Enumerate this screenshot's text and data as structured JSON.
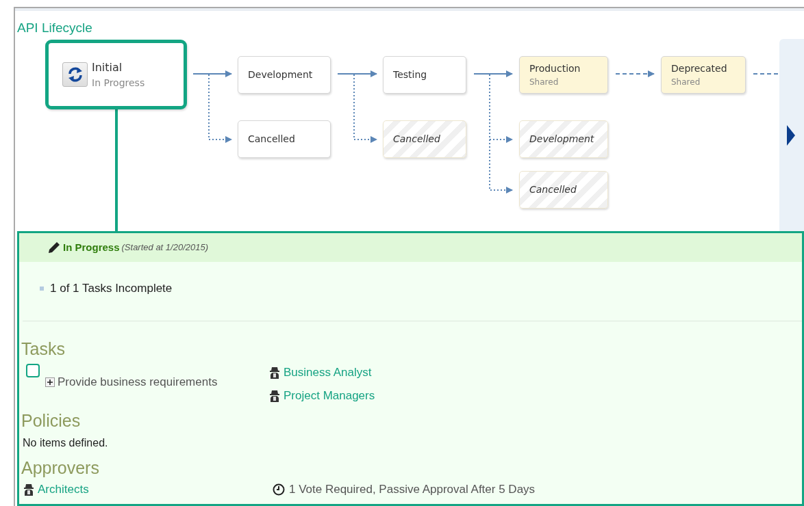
{
  "title": "API Lifecycle",
  "nodes": [
    {
      "label": "Initial",
      "sublabel": "In Progress",
      "kind": "current",
      "selected": true
    },
    {
      "label": "Development",
      "kind": "normal",
      "selected": false
    },
    {
      "label": "Testing",
      "kind": "normal",
      "selected": false
    },
    {
      "label": "Production",
      "sublabel": "Shared",
      "kind": "shared",
      "selected": false
    },
    {
      "label": "Deprecated",
      "sublabel": "Shared",
      "kind": "shared",
      "selected": false
    },
    {
      "label": "Cancelled",
      "kind": "normal",
      "selected": false
    },
    {
      "label": "Cancelled",
      "kind": "unavailable",
      "selected": false
    },
    {
      "label": "Development",
      "kind": "unavailable",
      "selected": false
    },
    {
      "label": "Cancelled",
      "kind": "unavailable",
      "selected": false
    }
  ],
  "stage_panel": {
    "status": "In Progress",
    "started": "(Started at 1/20/2015)",
    "summary": [
      "1 of 1 Tasks Incomplete"
    ],
    "sections": [
      {
        "kind": "tasks",
        "title": "Tasks",
        "items": [
          {
            "label": "Provide business requirements",
            "checked": false,
            "expanded": false,
            "assignees": [
              "Business Analyst",
              "Project Managers"
            ]
          }
        ]
      },
      {
        "kind": "empty",
        "title": "Policies",
        "message": "No items defined."
      },
      {
        "kind": "approvers",
        "title": "Approvers",
        "items": [
          {
            "group": "Architects",
            "rule": "1 Vote Required, Passive Approval After 5 Days"
          }
        ]
      }
    ]
  }
}
